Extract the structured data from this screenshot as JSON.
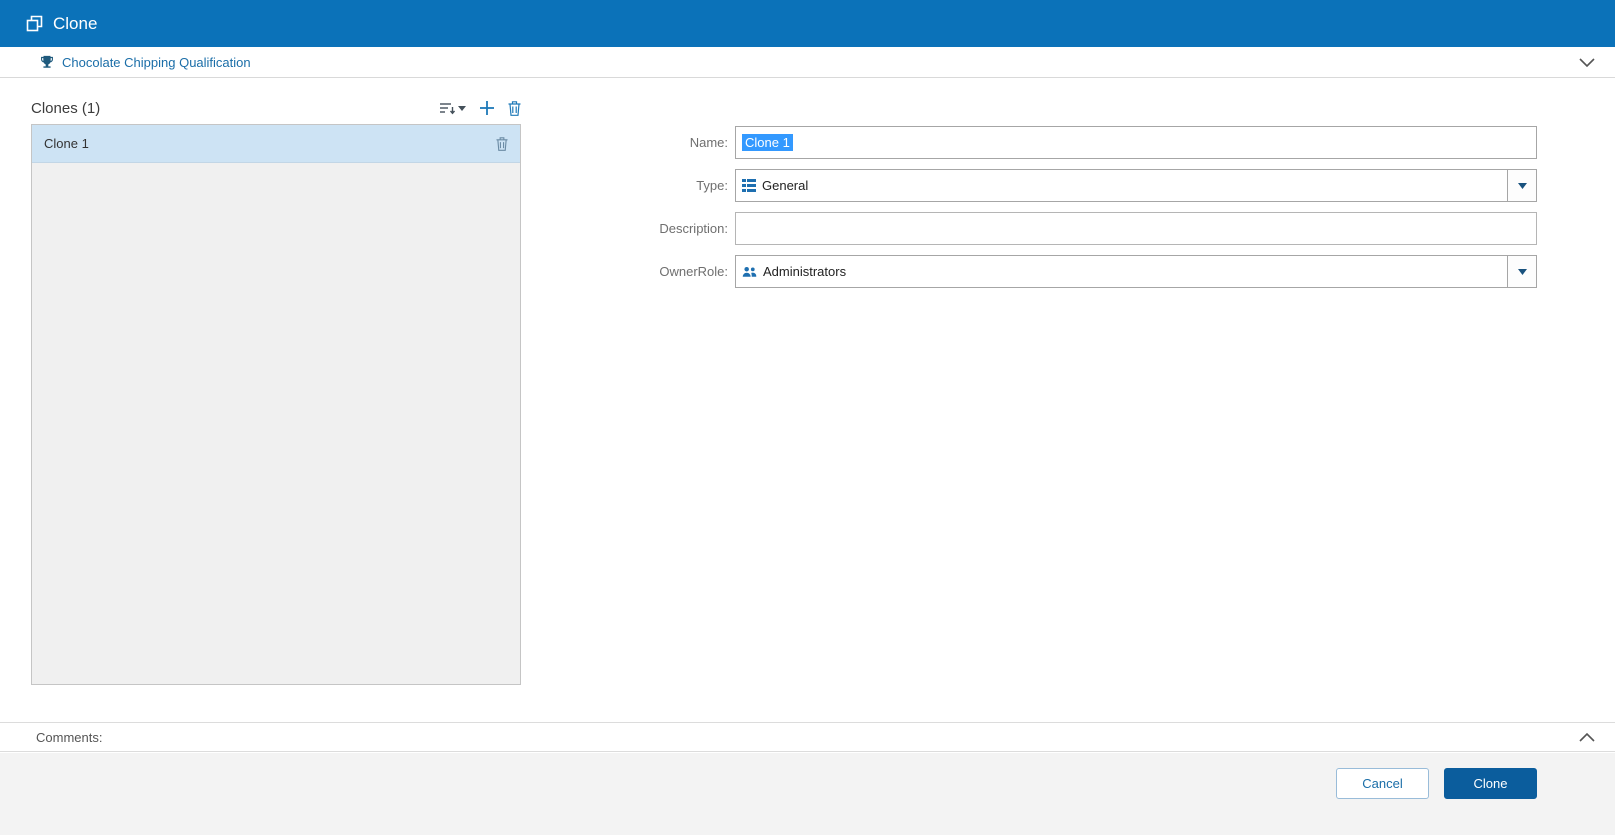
{
  "window": {
    "title": "Clone"
  },
  "breadcrumb": {
    "title": "Chocolate Chipping Qualification"
  },
  "clones_panel": {
    "title": "Clones (1)",
    "items": [
      {
        "label": "Clone 1",
        "selected": true
      }
    ]
  },
  "form": {
    "name_label": "Name:",
    "name_value": "Clone 1",
    "type_label": "Type:",
    "type_value": "General",
    "description_label": "Description:",
    "description_value": "",
    "owner_role_label": "OwnerRole:",
    "owner_role_value": "Administrators"
  },
  "comments": {
    "label": "Comments:"
  },
  "footer": {
    "cancel_label": "Cancel",
    "clone_label": "Clone"
  },
  "icons": {
    "header": "clone-icon",
    "breadcrumb_left": "trophy-icon",
    "breadcrumb_right": "chevron-down-icon",
    "list_toolbar": [
      "sort-icon",
      "add-icon",
      "delete-icon"
    ],
    "list_item_action": "delete-icon",
    "type_field": "table-view-icon",
    "owner_role_field": "people-icon",
    "comments_toggle": "chevron-up-icon",
    "combo_buttons": "caret-down-icon"
  },
  "colors": {
    "header_background": "#0b72b9",
    "link_blue": "#1b6ea8",
    "selection_highlight": "#3399ff",
    "selected_row": "#cde3f4",
    "primary_button": "#0b5d9d",
    "icon_blue": "#1e79b8"
  }
}
